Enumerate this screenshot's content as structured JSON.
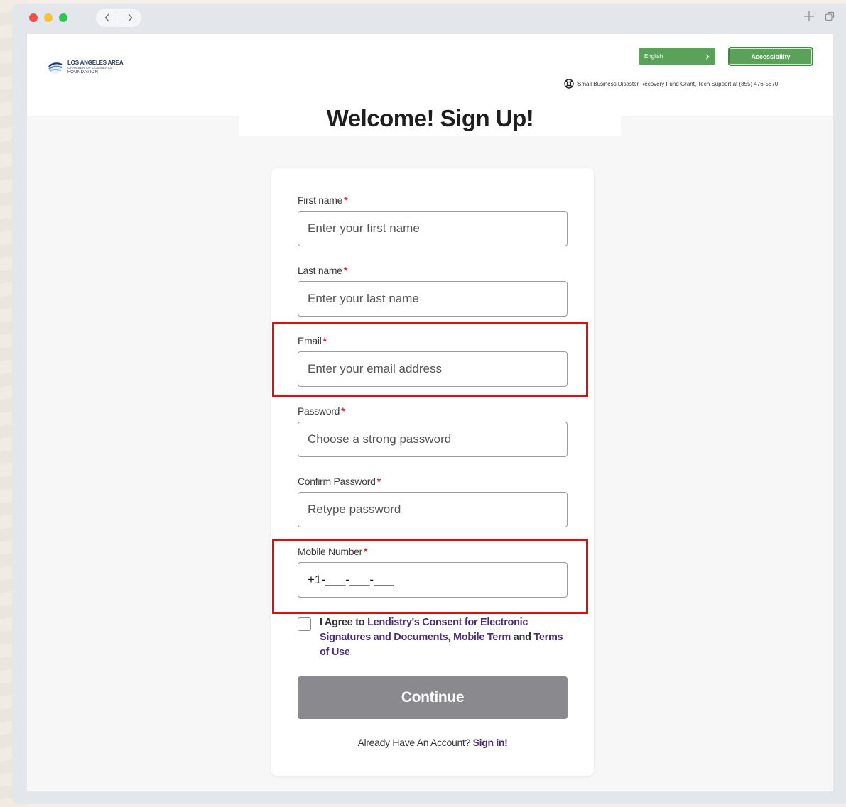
{
  "browser": {
    "back_icon": "chevron-left-icon",
    "forward_icon": "chevron-right-icon",
    "new_tab_icon": "plus-icon",
    "window_icon": "copy-icon"
  },
  "header": {
    "logo": {
      "line1": "LOS ANGELES AREA",
      "line2": "CHAMBER OF COMMERCE",
      "line3": "FOUNDATION"
    },
    "language": {
      "label": "English",
      "icon": "chevron-right-icon"
    },
    "accessibility_label": "Accessibility",
    "support_text": "Small Business Disaster Recovery Fund Grant, Tech Support at (855) 476-5870",
    "support_icon": "lifebuoy-icon"
  },
  "page": {
    "title": "Welcome! Sign Up!"
  },
  "form": {
    "required_mark": "*",
    "first_name": {
      "label": "First name",
      "placeholder": "Enter your first name"
    },
    "last_name": {
      "label": "Last name",
      "placeholder": "Enter your last name"
    },
    "email": {
      "label": "Email",
      "placeholder": "Enter your email address"
    },
    "password": {
      "label": "Password",
      "placeholder": "Choose a strong password"
    },
    "confirm_password": {
      "label": "Confirm Password",
      "placeholder": "Retype password"
    },
    "mobile": {
      "label": "Mobile Number",
      "value": "+1-___-___-___"
    },
    "agree": {
      "prefix": "I Agree to ",
      "consent_link": "Lendistry's Consent for Electronic Signatures and Documents, Mobile Term",
      "and": " and ",
      "terms_link": "Terms of Use"
    },
    "continue_label": "Continue",
    "signin_prompt": "Already Have An Account? ",
    "signin_link": "Sign in!"
  },
  "colors": {
    "accent_green": "#5aa25a",
    "link_purple": "#4b2d7f",
    "required_red": "#d0243b",
    "highlight_red": "#e00d0d",
    "button_gray": "#8a8a8e"
  }
}
